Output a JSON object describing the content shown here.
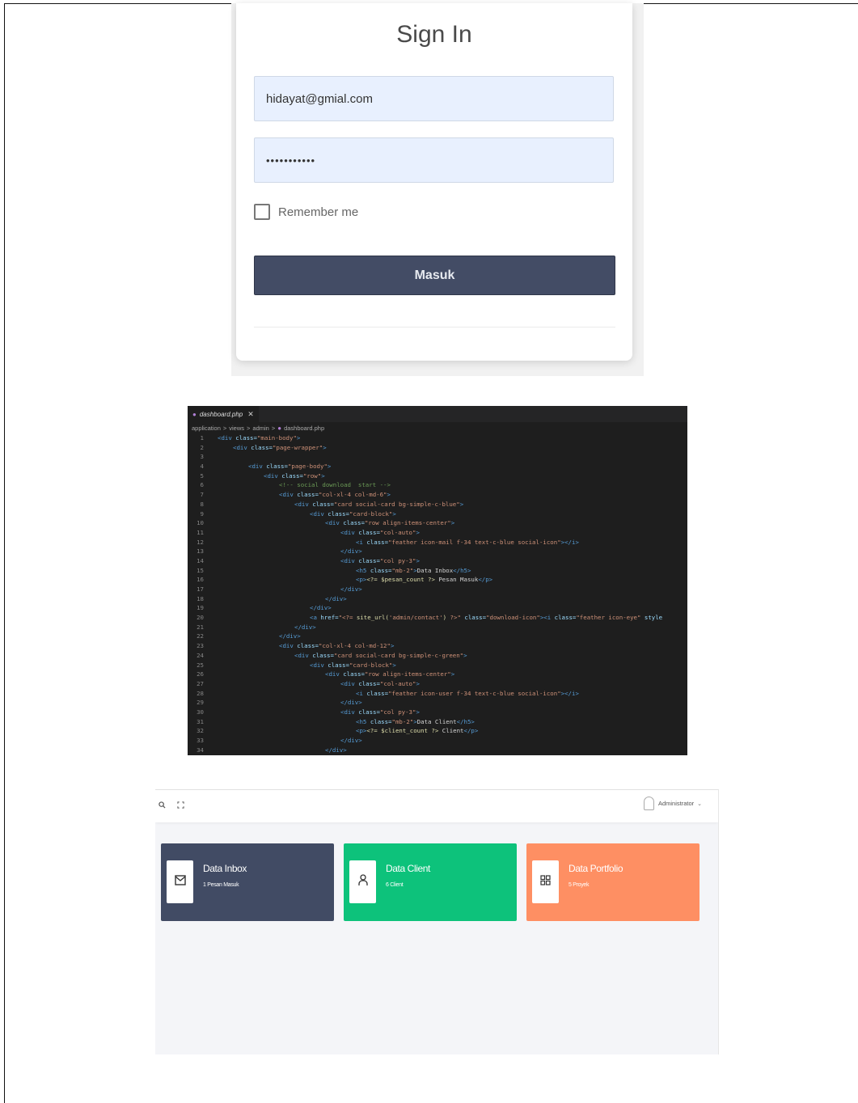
{
  "signin": {
    "title": "Sign In",
    "email_value": "hidayat@gmial.com",
    "password_value": "•••••••••••",
    "remember_label": "Remember me",
    "button_label": "Masuk",
    "colors": {
      "button": "#434c65",
      "input_bg": "#e8f0fe"
    }
  },
  "editor": {
    "tab_label": "dashboard.php",
    "breadcrumb": [
      "application",
      ">",
      "views",
      ">",
      "admin",
      ">",
      "dashboard.php"
    ],
    "lines": [
      {
        "n": "1",
        "segments": [
          {
            "k": "tag",
            "t": "<div "
          },
          {
            "k": "attr",
            "t": "class="
          },
          {
            "k": "str",
            "t": "\"main-body\""
          },
          {
            "k": "tag",
            "t": ">"
          }
        ],
        "indent": 0
      },
      {
        "n": "2",
        "segments": [
          {
            "k": "tag",
            "t": "<div "
          },
          {
            "k": "attr",
            "t": "class="
          },
          {
            "k": "str",
            "t": "\"page-wrapper\""
          },
          {
            "k": "tag",
            "t": ">"
          }
        ],
        "indent": 1
      },
      {
        "n": "3",
        "segments": [],
        "indent": 0
      },
      {
        "n": "4",
        "segments": [
          {
            "k": "tag",
            "t": "<div "
          },
          {
            "k": "attr",
            "t": "class="
          },
          {
            "k": "str",
            "t": "\"page-body\""
          },
          {
            "k": "tag",
            "t": ">"
          }
        ],
        "indent": 2
      },
      {
        "n": "5",
        "segments": [
          {
            "k": "tag",
            "t": "<div "
          },
          {
            "k": "attr",
            "t": "class="
          },
          {
            "k": "str",
            "t": "\"row\""
          },
          {
            "k": "tag",
            "t": ">"
          }
        ],
        "indent": 3
      },
      {
        "n": "6",
        "segments": [
          {
            "k": "cmt",
            "t": "<!-- social download  start -->"
          }
        ],
        "indent": 4
      },
      {
        "n": "7",
        "segments": [
          {
            "k": "tag",
            "t": "<div "
          },
          {
            "k": "attr",
            "t": "class="
          },
          {
            "k": "str",
            "t": "\"col-xl-4 col-md-6\""
          },
          {
            "k": "tag",
            "t": ">"
          }
        ],
        "indent": 4
      },
      {
        "n": "8",
        "segments": [
          {
            "k": "tag",
            "t": "<div "
          },
          {
            "k": "attr",
            "t": "class="
          },
          {
            "k": "str",
            "t": "\"card social-card bg-simple-c-blue\""
          },
          {
            "k": "tag",
            "t": ">"
          }
        ],
        "indent": 5
      },
      {
        "n": "9",
        "segments": [
          {
            "k": "tag",
            "t": "<div "
          },
          {
            "k": "attr",
            "t": "class="
          },
          {
            "k": "str",
            "t": "\"card-block\""
          },
          {
            "k": "tag",
            "t": ">"
          }
        ],
        "indent": 6
      },
      {
        "n": "10",
        "segments": [
          {
            "k": "tag",
            "t": "<div "
          },
          {
            "k": "attr",
            "t": "class="
          },
          {
            "k": "str",
            "t": "\"row align-items-center\""
          },
          {
            "k": "tag",
            "t": ">"
          }
        ],
        "indent": 7
      },
      {
        "n": "11",
        "segments": [
          {
            "k": "tag",
            "t": "<div "
          },
          {
            "k": "attr",
            "t": "class="
          },
          {
            "k": "str",
            "t": "\"col-auto\""
          },
          {
            "k": "tag",
            "t": ">"
          }
        ],
        "indent": 8
      },
      {
        "n": "12",
        "segments": [
          {
            "k": "tag",
            "t": "<i "
          },
          {
            "k": "attr",
            "t": "class="
          },
          {
            "k": "str",
            "t": "\"feather icon-mail f-34 text-c-blue social-icon\""
          },
          {
            "k": "tag",
            "t": "></i>"
          }
        ],
        "indent": 9
      },
      {
        "n": "13",
        "segments": [
          {
            "k": "tag",
            "t": "</div>"
          }
        ],
        "indent": 8
      },
      {
        "n": "14",
        "segments": [
          {
            "k": "tag",
            "t": "<div "
          },
          {
            "k": "attr",
            "t": "class="
          },
          {
            "k": "str",
            "t": "\"col py-3\""
          },
          {
            "k": "tag",
            "t": ">"
          }
        ],
        "indent": 8
      },
      {
        "n": "15",
        "segments": [
          {
            "k": "tag",
            "t": "<h5 "
          },
          {
            "k": "attr",
            "t": "class="
          },
          {
            "k": "str",
            "t": "\"mb-2\""
          },
          {
            "k": "tag",
            "t": ">"
          },
          {
            "k": "txt",
            "t": "Data Inbox"
          },
          {
            "k": "tag",
            "t": "</h5>"
          }
        ],
        "indent": 9
      },
      {
        "n": "16",
        "segments": [
          {
            "k": "tag",
            "t": "<p>"
          },
          {
            "k": "php",
            "t": "<?= $pesan_count ?>"
          },
          {
            "k": "txt",
            "t": " Pesan Masuk"
          },
          {
            "k": "tag",
            "t": "</p>"
          }
        ],
        "indent": 9
      },
      {
        "n": "17",
        "segments": [
          {
            "k": "tag",
            "t": "</div>"
          }
        ],
        "indent": 8
      },
      {
        "n": "18",
        "segments": [
          {
            "k": "tag",
            "t": "</div>"
          }
        ],
        "indent": 7
      },
      {
        "n": "19",
        "segments": [
          {
            "k": "tag",
            "t": "</div>"
          }
        ],
        "indent": 6
      },
      {
        "n": "20",
        "segments": [
          {
            "k": "tag",
            "t": "<a "
          },
          {
            "k": "attr",
            "t": "href="
          },
          {
            "k": "str",
            "t": "\"<?= "
          },
          {
            "k": "php",
            "t": "site_url("
          },
          {
            "k": "str",
            "t": "'admin/contact'"
          },
          {
            "k": "php",
            "t": ")"
          },
          {
            "k": "str",
            "t": " ?>\""
          },
          {
            "k": "attr",
            "t": " class="
          },
          {
            "k": "str",
            "t": "\"download-icon\""
          },
          {
            "k": "tag",
            "t": "><i "
          },
          {
            "k": "attr",
            "t": "class="
          },
          {
            "k": "str",
            "t": "\"feather icon-eye\""
          },
          {
            "k": "attr",
            "t": " style"
          }
        ],
        "indent": 6
      },
      {
        "n": "21",
        "segments": [
          {
            "k": "tag",
            "t": "</div>"
          }
        ],
        "indent": 5
      },
      {
        "n": "22",
        "segments": [
          {
            "k": "tag",
            "t": "</div>"
          }
        ],
        "indent": 4
      },
      {
        "n": "23",
        "segments": [
          {
            "k": "tag",
            "t": "<div "
          },
          {
            "k": "attr",
            "t": "class="
          },
          {
            "k": "str",
            "t": "\"col-xl-4 col-md-12\""
          },
          {
            "k": "tag",
            "t": ">"
          }
        ],
        "indent": 4
      },
      {
        "n": "24",
        "segments": [
          {
            "k": "tag",
            "t": "<div "
          },
          {
            "k": "attr",
            "t": "class="
          },
          {
            "k": "str",
            "t": "\"card social-card bg-simple-c-green\""
          },
          {
            "k": "tag",
            "t": ">"
          }
        ],
        "indent": 5
      },
      {
        "n": "25",
        "segments": [
          {
            "k": "tag",
            "t": "<div "
          },
          {
            "k": "attr",
            "t": "class="
          },
          {
            "k": "str",
            "t": "\"card-block\""
          },
          {
            "k": "tag",
            "t": ">"
          }
        ],
        "indent": 6
      },
      {
        "n": "26",
        "segments": [
          {
            "k": "tag",
            "t": "<div "
          },
          {
            "k": "attr",
            "t": "class="
          },
          {
            "k": "str",
            "t": "\"row align-items-center\""
          },
          {
            "k": "tag",
            "t": ">"
          }
        ],
        "indent": 7
      },
      {
        "n": "27",
        "segments": [
          {
            "k": "tag",
            "t": "<div "
          },
          {
            "k": "attr",
            "t": "class="
          },
          {
            "k": "str",
            "t": "\"col-auto\""
          },
          {
            "k": "tag",
            "t": ">"
          }
        ],
        "indent": 8
      },
      {
        "n": "28",
        "segments": [
          {
            "k": "tag",
            "t": "<i "
          },
          {
            "k": "attr",
            "t": "class="
          },
          {
            "k": "str",
            "t": "\"feather icon-user f-34 text-c-blue social-icon\""
          },
          {
            "k": "tag",
            "t": "></i>"
          }
        ],
        "indent": 9
      },
      {
        "n": "29",
        "segments": [
          {
            "k": "tag",
            "t": "</div>"
          }
        ],
        "indent": 8
      },
      {
        "n": "30",
        "segments": [
          {
            "k": "tag",
            "t": "<div "
          },
          {
            "k": "attr",
            "t": "class="
          },
          {
            "k": "str",
            "t": "\"col py-3\""
          },
          {
            "k": "tag",
            "t": ">"
          }
        ],
        "indent": 8
      },
      {
        "n": "31",
        "segments": [
          {
            "k": "tag",
            "t": "<h5 "
          },
          {
            "k": "attr",
            "t": "class="
          },
          {
            "k": "str",
            "t": "\"mb-2\""
          },
          {
            "k": "tag",
            "t": ">"
          },
          {
            "k": "txt",
            "t": "Data Client"
          },
          {
            "k": "tag",
            "t": "</h5>"
          }
        ],
        "indent": 9
      },
      {
        "n": "32",
        "segments": [
          {
            "k": "tag",
            "t": "<p>"
          },
          {
            "k": "php",
            "t": "<?= $client_count ?>"
          },
          {
            "k": "txt",
            "t": " Client"
          },
          {
            "k": "tag",
            "t": "</p>"
          }
        ],
        "indent": 9
      },
      {
        "n": "33",
        "segments": [
          {
            "k": "tag",
            "t": "</div>"
          }
        ],
        "indent": 8
      },
      {
        "n": "34",
        "segments": [
          {
            "k": "tag",
            "t": "</div>"
          }
        ],
        "indent": 7
      }
    ]
  },
  "dashboard": {
    "user_name": "Administrator",
    "cards": [
      {
        "title": "Data Inbox",
        "subtitle": "1 Pesan Masuk",
        "icon": "mail-icon",
        "color": "#414b64"
      },
      {
        "title": "Data Client",
        "subtitle": "6 Client",
        "icon": "user-icon",
        "color": "#0dc27b"
      },
      {
        "title": "Data Portfolio",
        "subtitle": "5 Proyek",
        "icon": "grid-icon",
        "color": "#fe8f63"
      }
    ]
  }
}
